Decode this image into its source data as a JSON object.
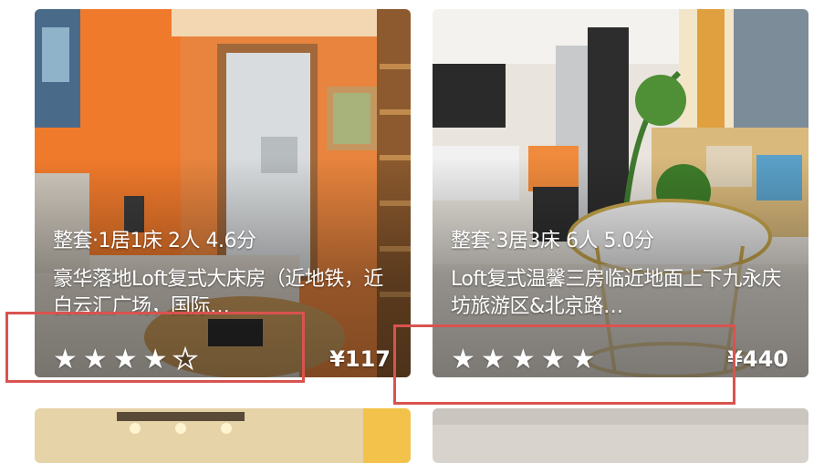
{
  "listings": [
    {
      "meta": "整套·1居1床 2人 4.6分",
      "title": "豪华落地Loft复式大床房（近地铁，近白云汇广场，国际…",
      "stars_filled": 4,
      "stars_total": 5,
      "price": "¥117"
    },
    {
      "meta": "整套·3居3床 6人 5.0分",
      "title": "Loft复式温馨三房临近地面上下九永庆坊旅游区&北京路…",
      "stars_filled": 5,
      "stars_total": 5,
      "price": "¥440"
    }
  ],
  "icons": {
    "star": "star-icon",
    "star_empty": "star-empty-icon"
  },
  "colors": {
    "highlight": "#d9534f",
    "text": "#ffffff"
  }
}
